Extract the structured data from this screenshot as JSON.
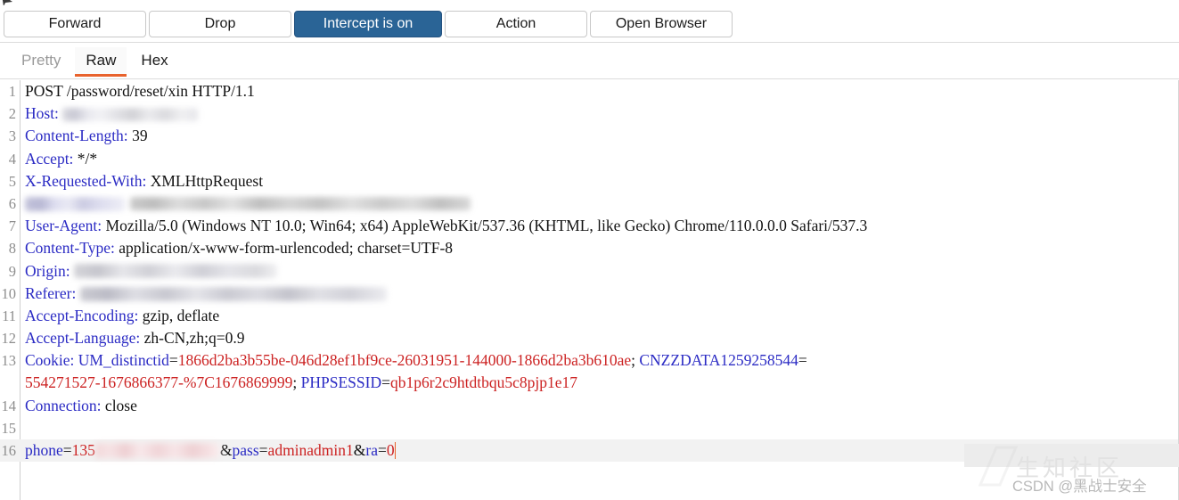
{
  "toolbar": {
    "forward_label": "Forward",
    "drop_label": "Drop",
    "intercept_label": "Intercept is on",
    "action_label": "Action",
    "open_browser_label": "Open Browser",
    "intercept_color": "#2a6496"
  },
  "view_tabs": {
    "pretty_label": "Pretty",
    "raw_label": "Raw",
    "hex_label": "Hex",
    "active": "Raw",
    "active_underline_color": "#e8622c"
  },
  "request": {
    "line_numbers": [
      "1",
      "2",
      "3",
      "4",
      "5",
      "6",
      "7",
      "8",
      "9",
      "10",
      "11",
      "12",
      "13",
      "",
      "14",
      "15",
      "16"
    ],
    "line1_request": "POST /password/reset/xin HTTP/1.1",
    "line2_header": "Host:",
    "line3_header": "Content-Length:",
    "line3_value": "39",
    "line4_header": "Accept:",
    "line4_value": "*/*",
    "line5_header": "X-Requested-With:",
    "line5_value": "XMLHttpRequest",
    "line7_header": "User-Agent:",
    "line7_value": "Mozilla/5.0 (Windows NT 10.0; Win64; x64) AppleWebKit/537.36 (KHTML, like Gecko) Chrome/110.0.0.0 Safari/537.3",
    "line8_header": "Content-Type:",
    "line8_value": "application/x-www-form-urlencoded; charset=UTF-8",
    "line9_header": "Origin:",
    "line10_header": "Referer:",
    "line11_header": "Accept-Encoding:",
    "line11_value": "gzip, deflate",
    "line12_header": "Accept-Language:",
    "line12_value": "zh-CN,zh;q=0.9",
    "line13_header": "Cookie:",
    "cookie_key1": "UM_distinctid",
    "cookie_val1": "1866d2ba3b55be-046d28ef1bf9ce-26031951-144000-1866d2ba3b610ae",
    "cookie_key2": "CNZZDATA1259258544",
    "cookie_val2_wrapped": "554271527-1676866377-%7C1676869999",
    "cookie_key3": "PHPSESSID",
    "cookie_val3": "qb1p6r2c9htdtbqu5c8pjp1e17",
    "line14_header": "Connection:",
    "line14_value": "close",
    "body_key1": "phone",
    "body_val1_prefix": "135",
    "body_key2": "pass",
    "body_val2": "adminadmin1",
    "body_key3": "ra",
    "body_val3": "0",
    "header_color": "#2b2bc4",
    "cookie_value_color": "#cc2222"
  },
  "watermark": {
    "text": "CSDN @黑战士安全",
    "ghost_text": "生知社区"
  }
}
